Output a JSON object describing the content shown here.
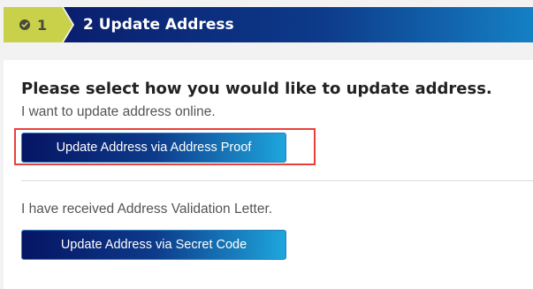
{
  "steps": {
    "completed_number": "1",
    "current_label": "2 Update Address"
  },
  "section": {
    "heading": "Please select how you would like to update address.",
    "online_text": "I want to update address online.",
    "address_proof_button": "Update Address via Address Proof",
    "letter_text": "I have received Address Validation Letter.",
    "secret_code_button": "Update Address via Secret Code"
  },
  "icons": {
    "completed_step": "check-circle-icon"
  },
  "colors": {
    "completed_step_bg": "#c9d14a",
    "current_step_bg": "#0d3a8a",
    "button_gradient_start": "#061463",
    "button_gradient_end": "#1ea6dc",
    "highlight_border": "#e8413a"
  }
}
